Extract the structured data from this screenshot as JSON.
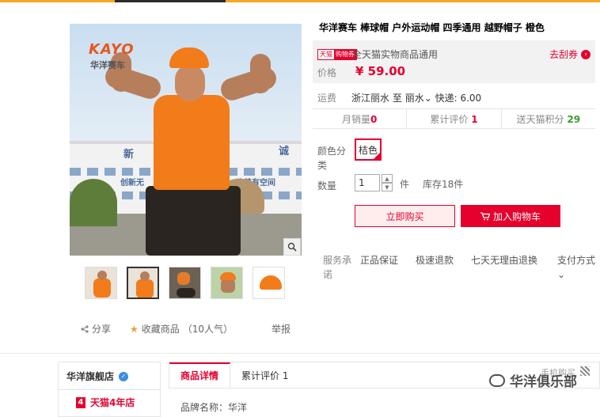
{
  "product": {
    "title": "华洋赛车 棒球帽 户外运动帽 四季通用 越野帽子 橙色",
    "image": {
      "brand_logo": "KAYO",
      "brand_sub": "华洋赛车",
      "building_text_1": "新",
      "building_text_2": "诚",
      "building_text_3": "创新无",
      "building_text_4": "改善有空间"
    },
    "zoom_icon": "magnifier-icon",
    "thumbnails": [
      {
        "name": "thumb-1"
      },
      {
        "name": "thumb-2"
      },
      {
        "name": "thumb-3"
      },
      {
        "name": "thumb-4"
      },
      {
        "name": "thumb-5"
      }
    ],
    "share_label": "分享",
    "favorite_label": "收藏商品",
    "favorite_count": "（10人气）",
    "report_label": "举报"
  },
  "promo": {
    "tag_left": "天猫",
    "tag_right": "购物券",
    "text": "全天猫实物商品通用",
    "link": "去刮券"
  },
  "price": {
    "label": "价格",
    "value": "¥ 59.00"
  },
  "shipping": {
    "label": "运费",
    "from": "浙江丽水",
    "to_word": "至",
    "to": "丽水",
    "express": "快递: 6.00"
  },
  "stats": {
    "monthly_label": "月销量",
    "monthly_value": "0",
    "reviews_label": "累计评价",
    "reviews_value": "1",
    "points_label": "送天猫积分",
    "points_value": "29"
  },
  "options": {
    "color_label": "颜色分类",
    "color_value": "桔色",
    "qty_label": "数量",
    "qty_value": "1",
    "qty_unit": "件",
    "stock": "库存18件"
  },
  "actions": {
    "buy_now": "立即购买",
    "add_cart": "加入购物车"
  },
  "service": {
    "label": "服务承诺",
    "items": [
      "正品保证",
      "极速退款",
      "七天无理由退换"
    ],
    "payment": "支付方式"
  },
  "shop": {
    "name": "华洋旗舰店",
    "years_num": "4",
    "years_label": "天猫4年店"
  },
  "tabs": {
    "detail": "商品详情",
    "reviews": "累计评价 1"
  },
  "detail_first_line": "品牌名称：华洋",
  "overlay": {
    "phone_buy": "手机购买",
    "watermark": "华洋俱乐部"
  },
  "colors": {
    "accent": "#e5002d",
    "orange": "#f27b1a",
    "green": "#3a9b34"
  }
}
